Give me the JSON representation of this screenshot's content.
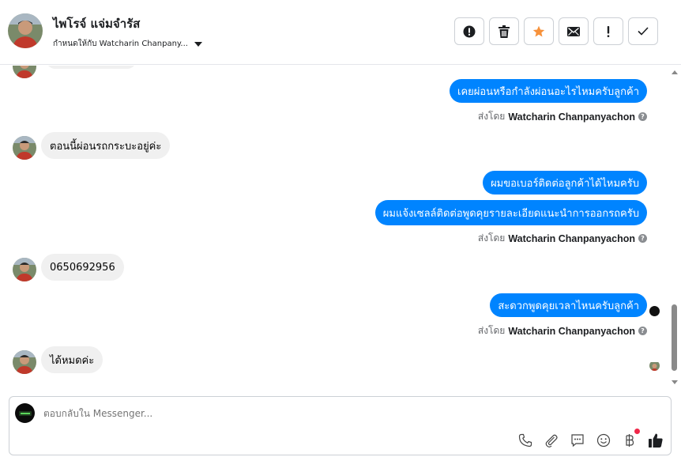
{
  "header": {
    "contact_name": "ไพโรจ์ แจ่มจำรัส",
    "assigned_text": "กำหนดให้กับ Watcharin Chanpany...",
    "actions": [
      {
        "name": "spam-button",
        "icon": "alert-circle-icon"
      },
      {
        "name": "delete-button",
        "icon": "trash-icon"
      },
      {
        "name": "star-button",
        "icon": "star-icon"
      },
      {
        "name": "mark-unread-button",
        "icon": "envelope-icon"
      },
      {
        "name": "follow-up-button",
        "icon": "exclamation-icon"
      },
      {
        "name": "mark-done-button",
        "icon": "check-icon"
      }
    ]
  },
  "messages": [
    {
      "dir": "out",
      "text": "เคยผ่อนหรือกำลังผ่อนอะไรไหมครับลูกค้า"
    },
    {
      "dir": "in",
      "text": "ตอนนี้ผ่อนรถกระบะอยู่ค่ะ"
    },
    {
      "dir": "out",
      "text": "ผมขอเบอร์ติดต่อลูกค้าได้ไหมครับ"
    },
    {
      "dir": "out",
      "text": "ผมแจ้งเซลล์ติดต่อพูดคุยรายละเอียดแนะนำการออกรถครับ"
    },
    {
      "dir": "in",
      "text": "0650692956"
    },
    {
      "dir": "out",
      "text": "สะดวกพูดคุยเวลาไหนครับลูกค้า"
    },
    {
      "dir": "in",
      "text": "ได้หมดค่ะ"
    }
  ],
  "sent_by": {
    "prefix": "ส่งโดย",
    "agent": "Watcharin Chanpanyachon",
    "help": "?"
  },
  "composer": {
    "placeholder": "ตอบกลับใน Messenger..."
  },
  "colors": {
    "outgoing_bubble": "#0084ff",
    "incoming_bubble": "#f0f0f0",
    "star": "#f7923b",
    "notification": "#f02849"
  }
}
